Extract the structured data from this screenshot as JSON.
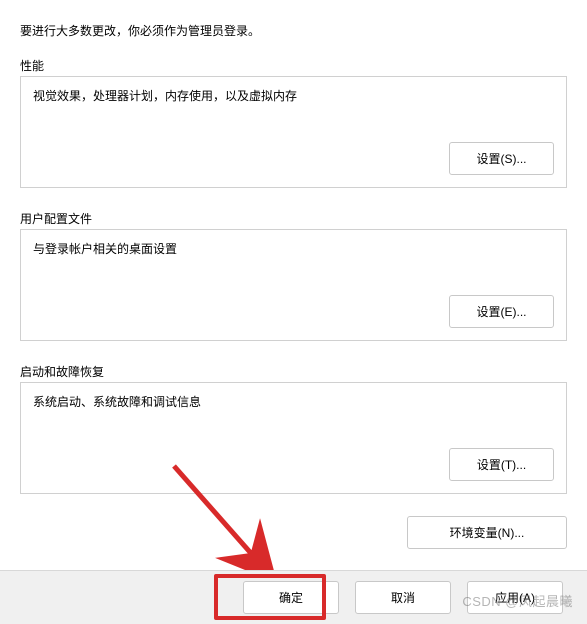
{
  "intro": "要进行大多数更改，你必须作为管理员登录。",
  "groups": {
    "performance": {
      "label": "性能",
      "desc": "视觉效果，处理器计划，内存使用，以及虚拟内存",
      "button": "设置(S)..."
    },
    "userprofile": {
      "label": "用户配置文件",
      "desc": "与登录帐户相关的桌面设置",
      "button": "设置(E)..."
    },
    "startup": {
      "label": "启动和故障恢复",
      "desc": "系统启动、系统故障和调试信息",
      "button": "设置(T)..."
    }
  },
  "env_button": "环境变量(N)...",
  "bottom": {
    "ok": "确定",
    "cancel": "取消",
    "apply": "应用(A)"
  },
  "watermark": "CSDN @风起晨曦"
}
